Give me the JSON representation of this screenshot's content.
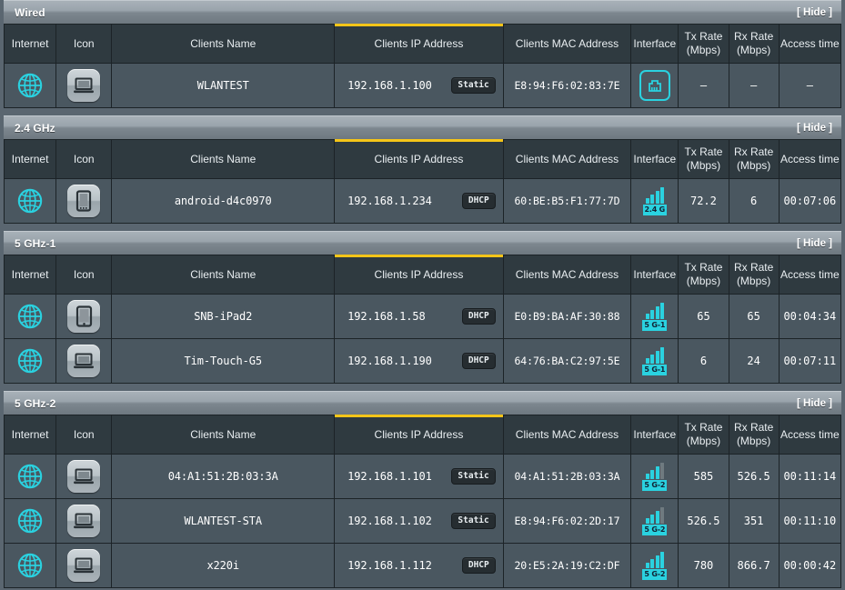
{
  "colors": {
    "accent_sorted": "#f5c518",
    "cyan": "#2ad2e0",
    "row_bg": "#4a5760",
    "header_bg": "#2f3a40",
    "page_bg": "#5a6670"
  },
  "common": {
    "hide_label": "[ Hide ]",
    "columns": [
      "Internet",
      "Icon",
      "Clients Name",
      "Clients IP Address",
      "Clients MAC Address",
      "Interface",
      "Tx Rate\n(Mbps)",
      "Rx Rate\n(Mbps)",
      "Access time"
    ],
    "column_tx_line1": "Tx Rate",
    "column_tx_line2": "(Mbps)",
    "column_rx_line1": "Rx Rate",
    "column_rx_line2": "(Mbps)",
    "sorted_column": "Clients IP Address"
  },
  "sections": [
    {
      "title": "Wired",
      "hide_label": "[ Hide ]",
      "rows": [
        {
          "internet_icon": "globe-icon",
          "device_icon": "laptop-icon",
          "name": "WLANTEST",
          "ip": "192.168.1.100",
          "ip_type": "Static",
          "mac": "E8:94:F6:02:83:7E",
          "interface_icon": "ethernet-port-icon",
          "interface_band": "",
          "signal_bars": 0,
          "tx_rate": "–",
          "rx_rate": "–",
          "access_time": "–"
        }
      ]
    },
    {
      "title": "2.4 GHz",
      "hide_label": "[ Hide ]",
      "rows": [
        {
          "internet_icon": "globe-icon",
          "device_icon": "phone-icon",
          "name": "android-d4c0970",
          "ip": "192.168.1.234",
          "ip_type": "DHCP",
          "mac": "60:BE:B5:F1:77:7D",
          "interface_icon": "wifi-signal-icon",
          "interface_band": "2.4 G",
          "signal_bars": 4,
          "tx_rate": "72.2",
          "rx_rate": "6",
          "access_time": "00:07:06"
        }
      ]
    },
    {
      "title": "5 GHz-1",
      "hide_label": "[ Hide ]",
      "rows": [
        {
          "internet_icon": "globe-icon",
          "device_icon": "tablet-icon",
          "name": "SNB-iPad2",
          "ip": "192.168.1.58",
          "ip_type": "DHCP",
          "mac": "E0:B9:BA:AF:30:88",
          "interface_icon": "wifi-signal-icon",
          "interface_band": "5 G-1",
          "signal_bars": 4,
          "tx_rate": "65",
          "rx_rate": "65",
          "access_time": "00:04:34"
        },
        {
          "internet_icon": "globe-icon",
          "device_icon": "laptop-icon",
          "name": "Tim-Touch-G5",
          "ip": "192.168.1.190",
          "ip_type": "DHCP",
          "mac": "64:76:BA:C2:97:5E",
          "interface_icon": "wifi-signal-icon",
          "interface_band": "5 G-1",
          "signal_bars": 4,
          "tx_rate": "6",
          "rx_rate": "24",
          "access_time": "00:07:11"
        }
      ]
    },
    {
      "title": "5 GHz-2",
      "hide_label": "[ Hide ]",
      "rows": [
        {
          "internet_icon": "globe-icon",
          "device_icon": "laptop-icon",
          "name": "04:A1:51:2B:03:3A",
          "ip": "192.168.1.101",
          "ip_type": "Static",
          "mac": "04:A1:51:2B:03:3A",
          "interface_icon": "wifi-signal-icon",
          "interface_band": "5 G-2",
          "signal_bars": 3,
          "tx_rate": "585",
          "rx_rate": "526.5",
          "access_time": "00:11:14"
        },
        {
          "internet_icon": "globe-icon",
          "device_icon": "laptop-icon",
          "name": "WLANTEST-STA",
          "ip": "192.168.1.102",
          "ip_type": "Static",
          "mac": "E8:94:F6:02:2D:17",
          "interface_icon": "wifi-signal-icon",
          "interface_band": "5 G-2",
          "signal_bars": 3,
          "tx_rate": "526.5",
          "rx_rate": "351",
          "access_time": "00:11:10"
        },
        {
          "internet_icon": "globe-icon",
          "device_icon": "laptop-icon",
          "name": "x220i",
          "ip": "192.168.1.112",
          "ip_type": "DHCP",
          "mac": "20:E5:2A:19:C2:DF",
          "interface_icon": "wifi-signal-icon",
          "interface_band": "5 G-2",
          "signal_bars": 4,
          "tx_rate": "780",
          "rx_rate": "866.7",
          "access_time": "00:00:42"
        }
      ]
    }
  ]
}
